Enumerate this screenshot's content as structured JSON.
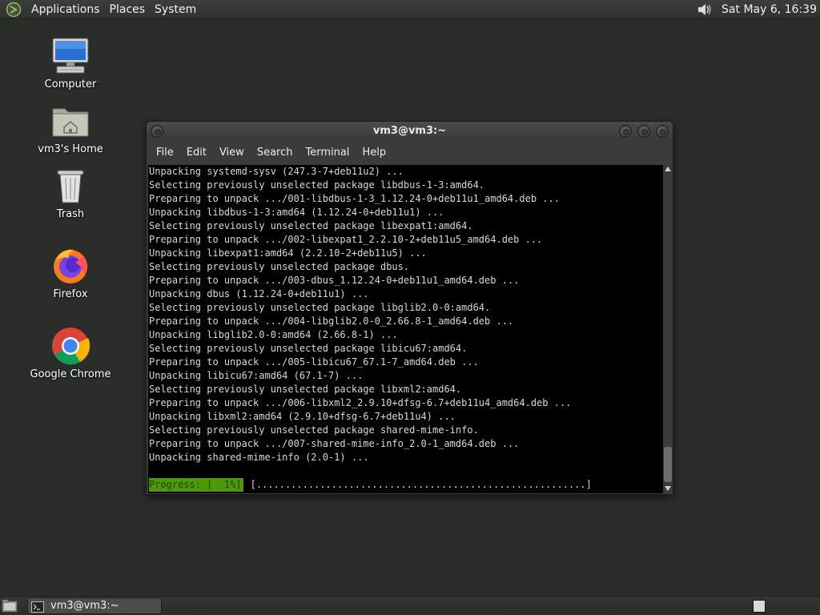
{
  "top_panel": {
    "menus": [
      "Applications",
      "Places",
      "System"
    ],
    "clock": "Sat May  6, 16:39"
  },
  "desktop_icons": [
    {
      "label": "Computer",
      "icon": "computer-icon"
    },
    {
      "label": "vm3's Home",
      "icon": "home-folder-icon"
    },
    {
      "label": "Trash",
      "icon": "trash-icon"
    },
    {
      "label": "Firefox",
      "icon": "firefox-icon"
    },
    {
      "label": "Google Chrome",
      "icon": "chrome-icon"
    }
  ],
  "terminal": {
    "title": "vm3@vm3:~",
    "menus": [
      "File",
      "Edit",
      "View",
      "Search",
      "Terminal",
      "Help"
    ],
    "lines": [
      "Unpacking systemd-sysv (247.3-7+deb11u2) ...",
      "Selecting previously unselected package libdbus-1-3:amd64.",
      "Preparing to unpack .../001-libdbus-1-3_1.12.24-0+deb11u1_amd64.deb ...",
      "Unpacking libdbus-1-3:amd64 (1.12.24-0+deb11u1) ...",
      "Selecting previously unselected package libexpat1:amd64.",
      "Preparing to unpack .../002-libexpat1_2.2.10-2+deb11u5_amd64.deb ...",
      "Unpacking libexpat1:amd64 (2.2.10-2+deb11u5) ...",
      "Selecting previously unselected package dbus.",
      "Preparing to unpack .../003-dbus_1.12.24-0+deb11u1_amd64.deb ...",
      "Unpacking dbus (1.12.24-0+deb11u1) ...",
      "Selecting previously unselected package libglib2.0-0:amd64.",
      "Preparing to unpack .../004-libglib2.0-0_2.66.8-1_amd64.deb ...",
      "Unpacking libglib2.0-0:amd64 (2.66.8-1) ...",
      "Selecting previously unselected package libicu67:amd64.",
      "Preparing to unpack .../005-libicu67_67.1-7_amd64.deb ...",
      "Unpacking libicu67:amd64 (67.1-7) ...",
      "Selecting previously unselected package libxml2:amd64.",
      "Preparing to unpack .../006-libxml2_2.9.10+dfsg-6.7+deb11u4_amd64.deb ...",
      "Unpacking libxml2:amd64 (2.9.10+dfsg-6.7+deb11u4) ...",
      "Selecting previously unselected package shared-mime-info.",
      "Preparing to unpack .../007-shared-mime-info_2.0-1_amd64.deb ...",
      "Unpacking shared-mime-info (2.0-1) ..."
    ],
    "progress_label": "Progress: [  1%]",
    "progress_bar": "[.........................................................]",
    "progress_percent": 1
  },
  "taskbar": {
    "window_button": "vm3@vm3:~"
  },
  "colors": {
    "desktop": "#2b2d2b",
    "terminal_bg": "#000000",
    "terminal_fg": "#d8d8d8",
    "progress_bg": "#4e9a06"
  }
}
